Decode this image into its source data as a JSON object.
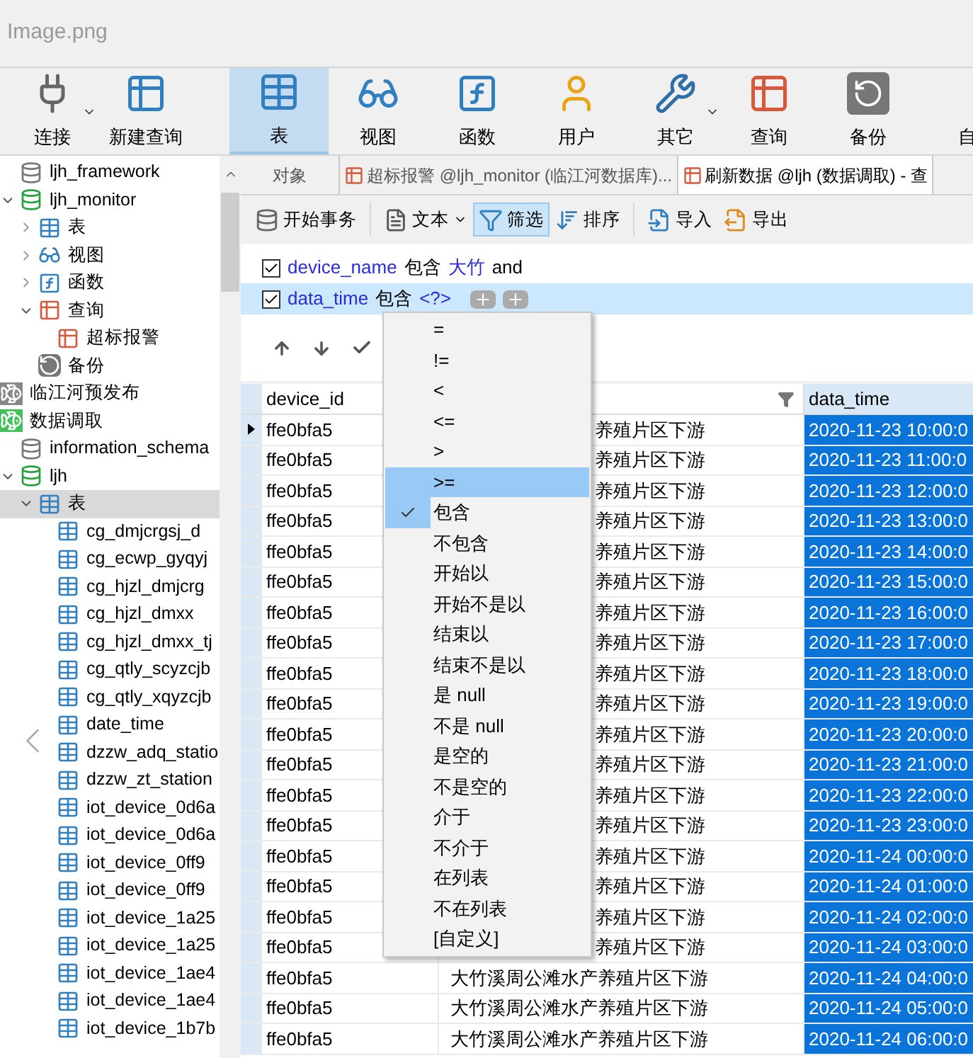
{
  "window": {
    "title": "Image.png"
  },
  "toolbar": [
    {
      "label": "连接",
      "kind": "connect",
      "dropdown": true,
      "selected": false
    },
    {
      "label": "新建查询",
      "kind": "newquery",
      "dropdown": false,
      "selected": false
    },
    {
      "label": "表",
      "kind": "table",
      "dropdown": false,
      "selected": true
    },
    {
      "label": "视图",
      "kind": "view",
      "dropdown": false,
      "selected": false
    },
    {
      "label": "函数",
      "kind": "function",
      "dropdown": false,
      "selected": false
    },
    {
      "label": "用户",
      "kind": "user",
      "dropdown": false,
      "selected": false
    },
    {
      "label": "其它",
      "kind": "other",
      "dropdown": true,
      "selected": false
    },
    {
      "label": "查询",
      "kind": "query",
      "dropdown": false,
      "selected": false
    },
    {
      "label": "备份",
      "kind": "backup",
      "dropdown": false,
      "selected": false
    },
    {
      "label": "自",
      "kind": "cut",
      "dropdown": false,
      "selected": false
    }
  ],
  "sidebar": {
    "items": [
      {
        "label": "ljh_framework",
        "kind": "database",
        "active": false,
        "selected": false
      },
      {
        "label": "ljh_monitor",
        "kind": "database",
        "active": true,
        "selected": false,
        "expanded": true,
        "children": [
          {
            "label": "表",
            "kind": "tables",
            "selected": false,
            "expanded": false
          },
          {
            "label": "视图",
            "kind": "views",
            "selected": false,
            "expanded": false
          },
          {
            "label": "函数",
            "kind": "functions",
            "selected": false,
            "expanded": false
          },
          {
            "label": "查询",
            "kind": "queries",
            "selected": false,
            "expanded": true,
            "children": [
              {
                "label": "超标报警",
                "kind": "query",
                "selected": false
              }
            ]
          },
          {
            "label": "备份",
            "kind": "backup",
            "selected": false
          }
        ]
      },
      {
        "label": "临江河预发布",
        "kind": "connection",
        "active": false,
        "selected": false
      },
      {
        "label": "数据调取",
        "kind": "connection",
        "active": true,
        "selected": false,
        "children": [
          {
            "label": "information_schema",
            "kind": "database",
            "active": false,
            "selected": false
          },
          {
            "label": "ljh",
            "kind": "database",
            "active": true,
            "selected": false,
            "expanded": true,
            "children": [
              {
                "label": "表",
                "kind": "tables",
                "selected": true,
                "expanded": true,
                "children": [
                  {
                    "label": "cg_dmjcrgsj_d",
                    "kind": "table",
                    "selected": false
                  },
                  {
                    "label": "cg_ecwp_gyqyj",
                    "kind": "table",
                    "selected": false
                  },
                  {
                    "label": "cg_hjzl_dmjcrg",
                    "kind": "table",
                    "selected": false
                  },
                  {
                    "label": "cg_hjzl_dmxx",
                    "kind": "table",
                    "selected": false
                  },
                  {
                    "label": "cg_hjzl_dmxx_tj",
                    "kind": "table",
                    "selected": false
                  },
                  {
                    "label": "cg_qtly_scyzcjb",
                    "kind": "table",
                    "selected": false
                  },
                  {
                    "label": "cg_qtly_xqyzcjb",
                    "kind": "table",
                    "selected": false
                  },
                  {
                    "label": "date_time",
                    "kind": "table",
                    "selected": false
                  },
                  {
                    "label": "dzzw_adq_statio",
                    "kind": "table",
                    "selected": false
                  },
                  {
                    "label": "dzzw_zt_station",
                    "kind": "table",
                    "selected": false
                  },
                  {
                    "label": "iot_device_0d6a",
                    "kind": "table",
                    "selected": false
                  },
                  {
                    "label": "iot_device_0d6a",
                    "kind": "table",
                    "selected": false
                  },
                  {
                    "label": "iot_device_0ff9",
                    "kind": "table",
                    "selected": false
                  },
                  {
                    "label": "iot_device_0ff9",
                    "kind": "table",
                    "selected": false
                  },
                  {
                    "label": "iot_device_1a25",
                    "kind": "table",
                    "selected": false
                  },
                  {
                    "label": "iot_device_1a25",
                    "kind": "table",
                    "selected": false
                  },
                  {
                    "label": "iot_device_1ae4",
                    "kind": "table",
                    "selected": false
                  },
                  {
                    "label": "iot_device_1ae4",
                    "kind": "table",
                    "selected": false
                  },
                  {
                    "label": "iot_device_1b7b",
                    "kind": "table",
                    "selected": false
                  }
                ]
              }
            ]
          }
        ]
      }
    ]
  },
  "tabs": [
    {
      "label": "对象",
      "kind": "objects",
      "selected": false
    },
    {
      "label": "超标报警 @ljh_monitor (临江河数据库)...",
      "kind": "query",
      "selected": false
    },
    {
      "label": "刷新数据 @ljh (数据调取) - 查",
      "kind": "query",
      "selected": true
    }
  ],
  "actions": [
    {
      "label": "开始事务",
      "kind": "transaction",
      "dropdown": false,
      "selected": false
    },
    {
      "label": "文本",
      "kind": "text",
      "dropdown": true,
      "selected": false
    },
    {
      "label": "筛选",
      "kind": "filter",
      "dropdown": false,
      "selected": true
    },
    {
      "label": "排序",
      "kind": "sort",
      "dropdown": false,
      "selected": false
    },
    {
      "label": "导入",
      "kind": "import",
      "dropdown": false,
      "selected": false
    },
    {
      "label": "导出",
      "kind": "export",
      "dropdown": false,
      "selected": false
    }
  ],
  "filters": [
    {
      "checked": true,
      "selected": false,
      "field": "device_name",
      "operator": "包含",
      "value": "大竹",
      "connector": "and"
    },
    {
      "checked": true,
      "selected": true,
      "field": "data_time",
      "operator": "包含",
      "value": "<?>"
    }
  ],
  "table": {
    "columns": [
      "device_id",
      "data_time"
    ],
    "rows": [
      {
        "current": true,
        "device_id": "ffe0bfa5",
        "device_name": "养殖片区下游",
        "kind": "covered",
        "data_time": "2020-11-23 10:00:0"
      },
      {
        "current": false,
        "device_id": "ffe0bfa5",
        "device_name": "养殖片区下游",
        "kind": "covered",
        "data_time": "2020-11-23 11:00:0"
      },
      {
        "current": false,
        "device_id": "ffe0bfa5",
        "device_name": "养殖片区下游",
        "kind": "covered",
        "data_time": "2020-11-23 12:00:0"
      },
      {
        "current": false,
        "device_id": "ffe0bfa5",
        "device_name": "养殖片区下游",
        "kind": "covered",
        "data_time": "2020-11-23 13:00:0"
      },
      {
        "current": false,
        "device_id": "ffe0bfa5",
        "device_name": "养殖片区下游",
        "kind": "covered",
        "data_time": "2020-11-23 14:00:0"
      },
      {
        "current": false,
        "device_id": "ffe0bfa5",
        "device_name": "养殖片区下游",
        "kind": "covered",
        "data_time": "2020-11-23 15:00:0"
      },
      {
        "current": false,
        "device_id": "ffe0bfa5",
        "device_name": "养殖片区下游",
        "kind": "covered",
        "data_time": "2020-11-23 16:00:0"
      },
      {
        "current": false,
        "device_id": "ffe0bfa5",
        "device_name": "养殖片区下游",
        "kind": "covered",
        "data_time": "2020-11-23 17:00:0"
      },
      {
        "current": false,
        "device_id": "ffe0bfa5",
        "device_name": "养殖片区下游",
        "kind": "covered",
        "data_time": "2020-11-23 18:00:0"
      },
      {
        "current": false,
        "device_id": "ffe0bfa5",
        "device_name": "养殖片区下游",
        "kind": "covered",
        "data_time": "2020-11-23 19:00:0"
      },
      {
        "current": false,
        "device_id": "ffe0bfa5",
        "device_name": "养殖片区下游",
        "kind": "covered",
        "data_time": "2020-11-23 20:00:0"
      },
      {
        "current": false,
        "device_id": "ffe0bfa5",
        "device_name": "养殖片区下游",
        "kind": "covered",
        "data_time": "2020-11-23 21:00:0"
      },
      {
        "current": false,
        "device_id": "ffe0bfa5",
        "device_name": "养殖片区下游",
        "kind": "covered",
        "data_time": "2020-11-23 22:00:0"
      },
      {
        "current": false,
        "device_id": "ffe0bfa5",
        "device_name": "养殖片区下游",
        "kind": "covered",
        "data_time": "2020-11-23 23:00:0"
      },
      {
        "current": false,
        "device_id": "ffe0bfa5",
        "device_name": "养殖片区下游",
        "kind": "covered",
        "data_time": "2020-11-24 00:00:0"
      },
      {
        "current": false,
        "device_id": "ffe0bfa5",
        "device_name": "养殖片区下游",
        "kind": "covered",
        "data_time": "2020-11-24 01:00:0"
      },
      {
        "current": false,
        "device_id": "ffe0bfa5",
        "device_name": "养殖片区下游",
        "kind": "covered",
        "data_time": "2020-11-24 02:00:0"
      },
      {
        "current": false,
        "device_id": "ffe0bfa5",
        "device_name": "养殖片区下游",
        "kind": "covered",
        "data_time": "2020-11-24 03:00:0"
      },
      {
        "current": false,
        "device_id": "ffe0bfa5",
        "device_name": "大竹溪周公滩水产养殖片区下游",
        "kind": "full",
        "data_time": "2020-11-24 04:00:0"
      },
      {
        "current": false,
        "device_id": "ffe0bfa5",
        "device_name": "大竹溪周公滩水产养殖片区下游",
        "kind": "full",
        "data_time": "2020-11-24 05:00:0"
      },
      {
        "current": false,
        "device_id": "ffe0bfa5",
        "device_name": "大竹溪周公滩水产养殖片区下游",
        "kind": "full",
        "data_time": "2020-11-24 06:00:0"
      }
    ]
  },
  "operator_menu": [
    {
      "label": "=",
      "selected": false,
      "checked": false
    },
    {
      "label": "!=",
      "selected": false,
      "checked": false
    },
    {
      "label": "<",
      "selected": false,
      "checked": false
    },
    {
      "label": "<=",
      "selected": false,
      "checked": false
    },
    {
      "label": ">",
      "selected": false,
      "checked": false
    },
    {
      "label": ">=",
      "selected": true,
      "checked": false
    },
    {
      "label": "包含",
      "selected": false,
      "checked": true
    },
    {
      "label": "不包含",
      "selected": false,
      "checked": false
    },
    {
      "label": "开始以",
      "selected": false,
      "checked": false
    },
    {
      "label": "开始不是以",
      "selected": false,
      "checked": false
    },
    {
      "label": "结束以",
      "selected": false,
      "checked": false
    },
    {
      "label": "结束不是以",
      "selected": false,
      "checked": false
    },
    {
      "label": "是 null",
      "selected": false,
      "checked": false
    },
    {
      "label": "不是 null",
      "selected": false,
      "checked": false
    },
    {
      "label": "是空的",
      "selected": false,
      "checked": false
    },
    {
      "label": "不是空的",
      "selected": false,
      "checked": false
    },
    {
      "label": "介于",
      "selected": false,
      "checked": false
    },
    {
      "label": "不介于",
      "selected": false,
      "checked": false
    },
    {
      "label": "在列表",
      "selected": false,
      "checked": false
    },
    {
      "label": "不在列表",
      "selected": false,
      "checked": false
    },
    {
      "label": "[自定义]",
      "selected": false,
      "checked": false
    }
  ]
}
